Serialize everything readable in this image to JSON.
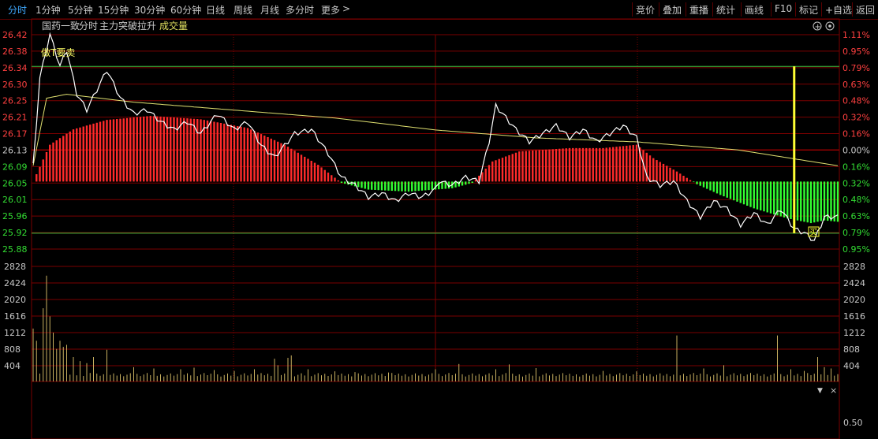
{
  "toolbar": {
    "periods": [
      "分时",
      "1分钟",
      "5分钟",
      "15分钟",
      "30分钟",
      "60分钟",
      "日线",
      "周线",
      "月线",
      "多分时",
      "更多"
    ],
    "active_period": "分时",
    "more_arrow": ">",
    "right_buttons": [
      "竞价",
      "叠加",
      "重播",
      "统计",
      "画线",
      "F10",
      "标记",
      "+自选",
      "返回"
    ]
  },
  "info_bar": {
    "stock_name": "国药一致",
    "mode": "分时",
    "indicator": "主力突破拉升",
    "volume_label": "成交量",
    "annotation": "做T要卖",
    "buy_marker": "买",
    "plus_icon": "+",
    "gear_icon": "gear-icon"
  },
  "sub_panel": {
    "value_label": "0.50",
    "arrow": "▼",
    "close": "×"
  },
  "colors": {
    "up": "#ff2b2b",
    "down": "#33ff33",
    "price": "#ffffff",
    "avg": "#e0e070",
    "grid": "#7a0000",
    "volume": "#c8b060",
    "signal": "#ffff33",
    "hline": "#40c040"
  },
  "chart_data": {
    "type": "line",
    "price_axis": [
      "26.42",
      "26.38",
      "26.34",
      "26.30",
      "26.25",
      "26.21",
      "26.17",
      "26.13",
      "26.09",
      "26.05",
      "26.01",
      "25.96",
      "25.92",
      "25.88"
    ],
    "pct_axis": [
      "1.11%",
      "0.95%",
      "0.79%",
      "0.63%",
      "0.48%",
      "0.32%",
      "0.16%",
      "0.00%",
      "0.16%",
      "0.32%",
      "0.48%",
      "0.63%",
      "0.79%",
      "0.95%"
    ],
    "volume_axis": [
      "2828",
      "2424",
      "2020",
      "1616",
      "1212",
      "808",
      "404"
    ],
    "prev_close": 26.13,
    "ylim": [
      25.88,
      26.42
    ],
    "volume_ylim": [
      0,
      2828
    ],
    "minutes": 240,
    "price_keypoints": [
      [
        0,
        26.09
      ],
      [
        2,
        26.31
      ],
      [
        5,
        26.42
      ],
      [
        8,
        26.34
      ],
      [
        10,
        26.38
      ],
      [
        13,
        26.27
      ],
      [
        16,
        26.23
      ],
      [
        19,
        26.28
      ],
      [
        22,
        26.33
      ],
      [
        26,
        26.26
      ],
      [
        30,
        26.22
      ],
      [
        34,
        26.23
      ],
      [
        38,
        26.2
      ],
      [
        42,
        26.18
      ],
      [
        46,
        26.2
      ],
      [
        50,
        26.17
      ],
      [
        55,
        26.22
      ],
      [
        60,
        26.18
      ],
      [
        64,
        26.2
      ],
      [
        68,
        26.14
      ],
      [
        72,
        26.11
      ],
      [
        78,
        26.17
      ],
      [
        83,
        26.18
      ],
      [
        88,
        26.12
      ],
      [
        92,
        26.06
      ],
      [
        96,
        26.04
      ],
      [
        100,
        26.01
      ],
      [
        104,
        26.02
      ],
      [
        108,
        26.0
      ],
      [
        112,
        26.02
      ],
      [
        116,
        26.01
      ],
      [
        120,
        26.03
      ],
      [
        121,
        26.05
      ],
      [
        125,
        26.04
      ],
      [
        129,
        26.06
      ],
      [
        133,
        26.05
      ],
      [
        136,
        26.15
      ],
      [
        138,
        26.24
      ],
      [
        141,
        26.21
      ],
      [
        144,
        26.18
      ],
      [
        148,
        26.15
      ],
      [
        152,
        26.17
      ],
      [
        156,
        26.19
      ],
      [
        160,
        26.16
      ],
      [
        164,
        26.18
      ],
      [
        168,
        26.15
      ],
      [
        172,
        26.17
      ],
      [
        176,
        26.19
      ],
      [
        180,
        26.16
      ],
      [
        183,
        26.06
      ],
      [
        187,
        26.04
      ],
      [
        191,
        26.05
      ],
      [
        195,
        26.0
      ],
      [
        199,
        25.96
      ],
      [
        203,
        26.0
      ],
      [
        207,
        25.98
      ],
      [
        211,
        25.94
      ],
      [
        215,
        25.97
      ],
      [
        219,
        25.94
      ],
      [
        223,
        25.98
      ],
      [
        227,
        25.93
      ],
      [
        230,
        25.92
      ],
      [
        233,
        25.9
      ],
      [
        236,
        25.96
      ],
      [
        240,
        25.96
      ]
    ],
    "avg_keypoints": [
      [
        0,
        26.09
      ],
      [
        4,
        26.26
      ],
      [
        10,
        26.27
      ],
      [
        30,
        26.25
      ],
      [
        60,
        26.23
      ],
      [
        90,
        26.21
      ],
      [
        120,
        26.18
      ],
      [
        150,
        26.16
      ],
      [
        180,
        26.15
      ],
      [
        210,
        26.13
      ],
      [
        240,
        26.09
      ]
    ],
    "ind_keypoints": [
      [
        0,
        0.0
      ],
      [
        5,
        0.55
      ],
      [
        12,
        0.78
      ],
      [
        22,
        0.92
      ],
      [
        35,
        0.98
      ],
      [
        50,
        0.93
      ],
      [
        64,
        0.8
      ],
      [
        75,
        0.55
      ],
      [
        85,
        0.25
      ],
      [
        92,
        -0.02
      ],
      [
        100,
        -0.12
      ],
      [
        112,
        -0.15
      ],
      [
        125,
        -0.1
      ],
      [
        131,
        -0.02
      ],
      [
        137,
        0.3
      ],
      [
        145,
        0.45
      ],
      [
        160,
        0.5
      ],
      [
        170,
        0.5
      ],
      [
        180,
        0.55
      ],
      [
        185,
        0.35
      ],
      [
        192,
        0.15
      ],
      [
        198,
        -0.04
      ],
      [
        205,
        -0.2
      ],
      [
        215,
        -0.4
      ],
      [
        225,
        -0.55
      ],
      [
        232,
        -0.62
      ],
      [
        236,
        -0.58
      ],
      [
        240,
        -0.6
      ]
    ],
    "signal_minute": 227,
    "signal_top": 26.34,
    "signal_bottom": 25.92,
    "resistance": 26.34,
    "support": 25.92,
    "volume_peaks": [
      [
        0,
        1300
      ],
      [
        1,
        1000
      ],
      [
        3,
        1800
      ],
      [
        4,
        2600
      ],
      [
        5,
        1600
      ],
      [
        6,
        1200
      ],
      [
        7,
        800
      ],
      [
        8,
        1000
      ],
      [
        9,
        850
      ],
      [
        10,
        900
      ],
      [
        12,
        600
      ],
      [
        14,
        500
      ],
      [
        16,
        450
      ],
      [
        18,
        600
      ],
      [
        22,
        780
      ],
      [
        30,
        350
      ],
      [
        36,
        320
      ],
      [
        44,
        300
      ],
      [
        48,
        340
      ],
      [
        54,
        280
      ],
      [
        60,
        260
      ],
      [
        66,
        300
      ],
      [
        72,
        560
      ],
      [
        73,
        400
      ],
      [
        76,
        580
      ],
      [
        77,
        640
      ],
      [
        82,
        300
      ],
      [
        90,
        250
      ],
      [
        96,
        230
      ],
      [
        106,
        220
      ],
      [
        120,
        300
      ],
      [
        127,
        430
      ],
      [
        138,
        300
      ],
      [
        142,
        420
      ],
      [
        150,
        330
      ],
      [
        170,
        260
      ],
      [
        180,
        250
      ],
      [
        192,
        1130
      ],
      [
        200,
        320
      ],
      [
        206,
        400
      ],
      [
        222,
        1130
      ],
      [
        226,
        300
      ],
      [
        230,
        260
      ],
      [
        234,
        600
      ],
      [
        236,
        350
      ],
      [
        238,
        320
      ]
    ]
  }
}
